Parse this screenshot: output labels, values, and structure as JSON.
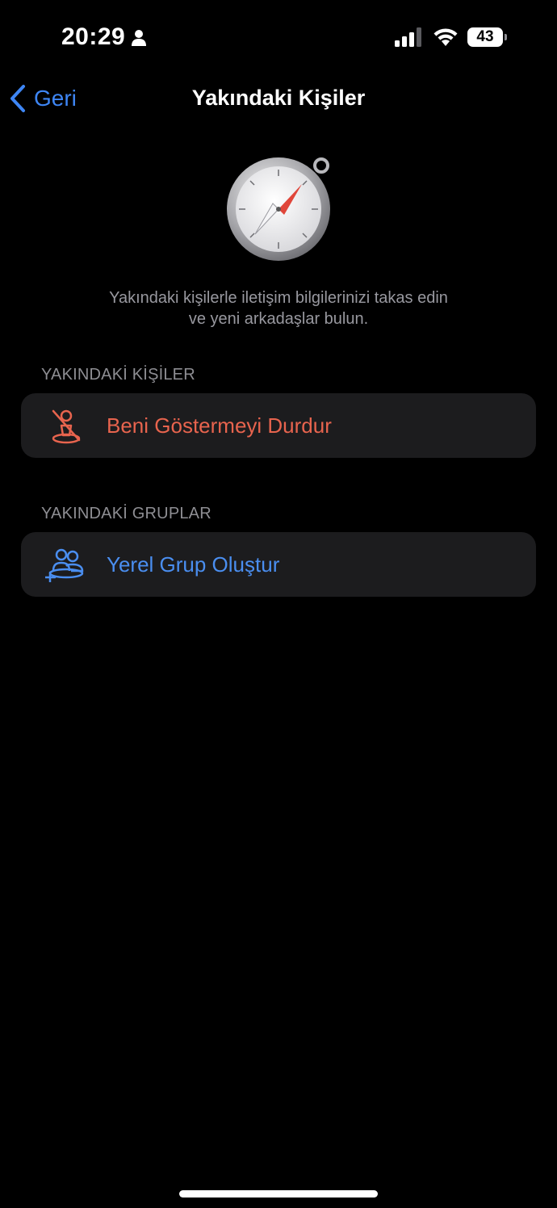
{
  "status_bar": {
    "time": "20:29",
    "battery_level": "43",
    "icons": [
      "person-icon",
      "signal-icon",
      "wifi-icon",
      "battery-icon"
    ]
  },
  "nav": {
    "back_label": "Geri",
    "title": "Yakındaki Kişiler"
  },
  "hero": {
    "icon": "compass-icon",
    "description_line1": "Yakındaki kişilerle iletişim bilgilerinizi takas edin",
    "description_line2": "ve yeni arkadaşlar bulun."
  },
  "sections": {
    "people_header": "YAKINDAKİ KİŞİLER",
    "stop_showing_label": "Beni Göstermeyi Durdur",
    "groups_header": "YAKINDAKİ GRUPLAR",
    "create_group_label": "Yerel Grup Oluştur"
  },
  "colors": {
    "accent_blue": "#3e86f5",
    "destructive_red": "#e8644e",
    "card_background": "#1c1c1e",
    "secondary_text": "#8e8e93"
  }
}
